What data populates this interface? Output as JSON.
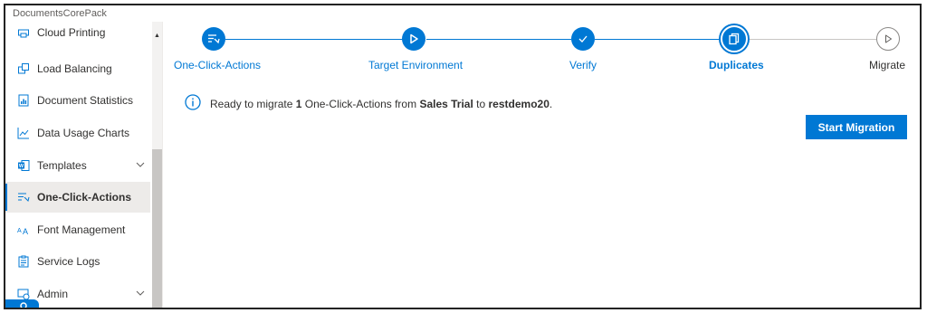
{
  "app": {
    "title": "DocumentsCorePack"
  },
  "sidebar": {
    "items": [
      {
        "label": "Cloud Printing",
        "icon": "cloud-printing-icon"
      },
      {
        "label": "Load Balancing",
        "icon": "load-balancing-icon"
      },
      {
        "label": "Document Statistics",
        "icon": "document-statistics-icon"
      },
      {
        "label": "Data Usage Charts",
        "icon": "line-chart-icon"
      },
      {
        "label": "Templates",
        "icon": "word-template-icon"
      },
      {
        "label": "One-Click-Actions",
        "icon": "one-click-actions-icon"
      },
      {
        "label": "Font Management",
        "icon": "font-icon"
      },
      {
        "label": "Service Logs",
        "icon": "log-icon"
      },
      {
        "label": "Admin",
        "icon": "admin-icon"
      }
    ]
  },
  "wizard": {
    "steps": [
      {
        "label": "One-Click-Actions",
        "icon": "one-click-actions-icon",
        "state": "done"
      },
      {
        "label": "Target Environment",
        "icon": "play-icon",
        "state": "done"
      },
      {
        "label": "Verify",
        "icon": "check-icon",
        "state": "done"
      },
      {
        "label": "Duplicates",
        "icon": "duplicates-icon",
        "state": "current"
      },
      {
        "label": "Migrate",
        "icon": "play-icon",
        "state": "pending"
      }
    ]
  },
  "message": {
    "text_1": "Ready to migrate ",
    "count": "1",
    "text_2": " One-Click-Actions from ",
    "source": "Sales Trial",
    "text_3": " to ",
    "target": "restdemo20",
    "text_4": "."
  },
  "actions": {
    "start_migration": "Start Migration"
  },
  "colors": {
    "accent": "#0078d4",
    "pending": "#8a8886"
  }
}
